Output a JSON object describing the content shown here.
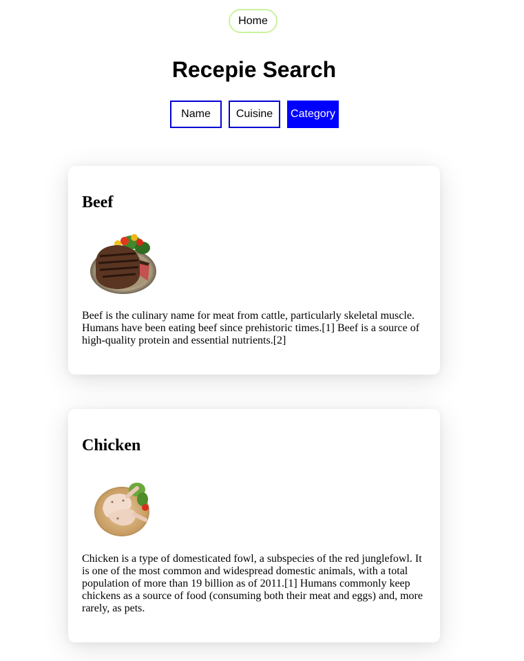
{
  "nav": {
    "home_label": "Home"
  },
  "page": {
    "title": "Recepie Search"
  },
  "tabs": [
    {
      "label": "Name",
      "active": false
    },
    {
      "label": "Cuisine",
      "active": false
    },
    {
      "label": "Category",
      "active": true
    }
  ],
  "categories": [
    {
      "title": "Beef",
      "image_icon": "beef-steak-plate-image",
      "description": "Beef is the culinary name for meat from cattle, particularly skeletal muscle. Humans have been eating beef since prehistoric times.[1] Beef is a source of high-quality protein and essential nutrients.[2]"
    },
    {
      "title": "Chicken",
      "image_icon": "chicken-legs-plate-image",
      "description": "Chicken is a type of domesticated fowl, a subspecies of the red junglefowl. It is one of the most common and widespread domestic animals, with a total population of more than 19 billion as of 2011.[1] Humans commonly keep chickens as a source of food (consuming both their meat and eggs) and, more rarely, as pets."
    }
  ],
  "colors": {
    "accent_blue": "#0000ff",
    "home_border": "#c9f29b"
  }
}
